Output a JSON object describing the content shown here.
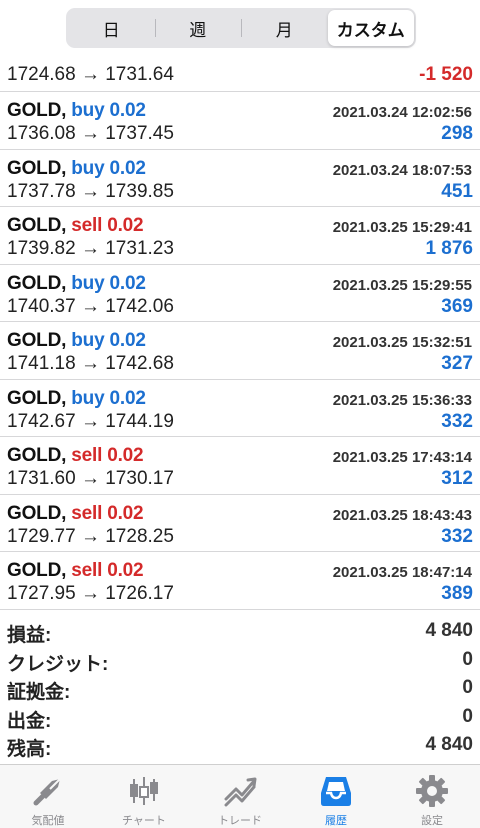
{
  "segments": [
    "日",
    "週",
    "月",
    "カスタム"
  ],
  "active_segment": "カスタム",
  "first_row": {
    "prices": "1724.68 → 1731.64",
    "profit": "-1 520"
  },
  "trades": [
    {
      "symbol": "GOLD,",
      "side": "buy 0.02",
      "date": "2021.03.24 12:02:56",
      "prices": "1736.08 → 1737.45",
      "profit": "298"
    },
    {
      "symbol": "GOLD,",
      "side": "buy 0.02",
      "date": "2021.03.24 18:07:53",
      "prices": "1737.78 → 1739.85",
      "profit": "451"
    },
    {
      "symbol": "GOLD,",
      "side": "sell 0.02",
      "date": "2021.03.25 15:29:41",
      "prices": "1739.82 → 1731.23",
      "profit": "1 876"
    },
    {
      "symbol": "GOLD,",
      "side": "buy 0.02",
      "date": "2021.03.25 15:29:55",
      "prices": "1740.37 → 1742.06",
      "profit": "369"
    },
    {
      "symbol": "GOLD,",
      "side": "buy 0.02",
      "date": "2021.03.25 15:32:51",
      "prices": "1741.18 → 1742.68",
      "profit": "327"
    },
    {
      "symbol": "GOLD,",
      "side": "buy 0.02",
      "date": "2021.03.25 15:36:33",
      "prices": "1742.67 → 1744.19",
      "profit": "332"
    },
    {
      "symbol": "GOLD,",
      "side": "sell 0.02",
      "date": "2021.03.25 17:43:14",
      "prices": "1731.60 → 1730.17",
      "profit": "312"
    },
    {
      "symbol": "GOLD,",
      "side": "sell 0.02",
      "date": "2021.03.25 18:43:43",
      "prices": "1729.77 → 1728.25",
      "profit": "332"
    },
    {
      "symbol": "GOLD,",
      "side": "sell 0.02",
      "date": "2021.03.25 18:47:14",
      "prices": "1727.95 → 1726.17",
      "profit": "389"
    }
  ],
  "summary": [
    {
      "label": "損益:",
      "value": "4 840"
    },
    {
      "label": "クレジット:",
      "value": "0"
    },
    {
      "label": "証拠金:",
      "value": "0"
    },
    {
      "label": "出金:",
      "value": "0"
    },
    {
      "label": "残高:",
      "value": "4 840"
    }
  ],
  "tabs": [
    {
      "label": "気配値",
      "icon": "quotes-icon"
    },
    {
      "label": "チャート",
      "icon": "chart-icon"
    },
    {
      "label": "トレード",
      "icon": "trade-icon"
    },
    {
      "label": "履歴",
      "icon": "history-icon"
    },
    {
      "label": "設定",
      "icon": "settings-icon"
    }
  ],
  "active_tab": "履歴",
  "colors": {
    "buy": "#1c6fd0",
    "sell": "#d42a2a",
    "tab_active": "#1a7fe6",
    "tab_inactive": "#8a8a8e"
  }
}
